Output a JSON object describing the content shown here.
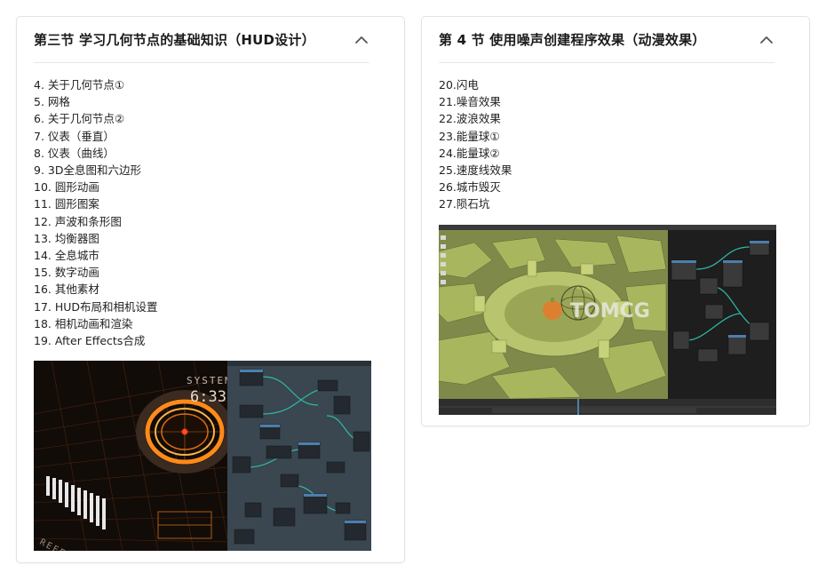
{
  "sections": [
    {
      "title": "第三节 学习几何节点的基础知识（HUD设计）",
      "collapse_icon": "chevron-up-icon",
      "lessons": [
        "4. 关于几何节点①",
        "5. 网格",
        "6. 关于几何节点②",
        "7. 仪表（垂直）",
        "8. 仪表（曲线）",
        "9. 3D全息图和六边形",
        "10. 圆形动画",
        "11. 圆形图案",
        "12. 声波和条形图",
        "13. 均衡器图",
        "14. 全息城市",
        "15. 数字动画",
        "16. 其他素材",
        "17. HUD布局和相机设置",
        "18. 相机动画和渲染",
        "19. After Effects合成"
      ],
      "image_text": [
        "SYSTEM",
        "6:33",
        "REFERENCE"
      ]
    },
    {
      "title": "第 4 节 使用噪声创建程序效果（动漫效果）",
      "collapse_icon": "chevron-up-icon",
      "lessons": [
        "20.闪电",
        "21.噪音效果",
        "22.波浪效果",
        "23.能量球①",
        "24.能量球②",
        "25.速度线效果",
        "26.城市毁灭",
        "27.陨石坑"
      ],
      "image_text": [
        "TOMCG"
      ]
    }
  ],
  "colors": {
    "card_border": "#e3e3e3",
    "hud_orange": "#ff8a1a",
    "hud_background": "#120c08",
    "node_editor": "#3a4650",
    "node_link_teal": "#2fb9a8",
    "terrain_green": "#a8b75e"
  }
}
